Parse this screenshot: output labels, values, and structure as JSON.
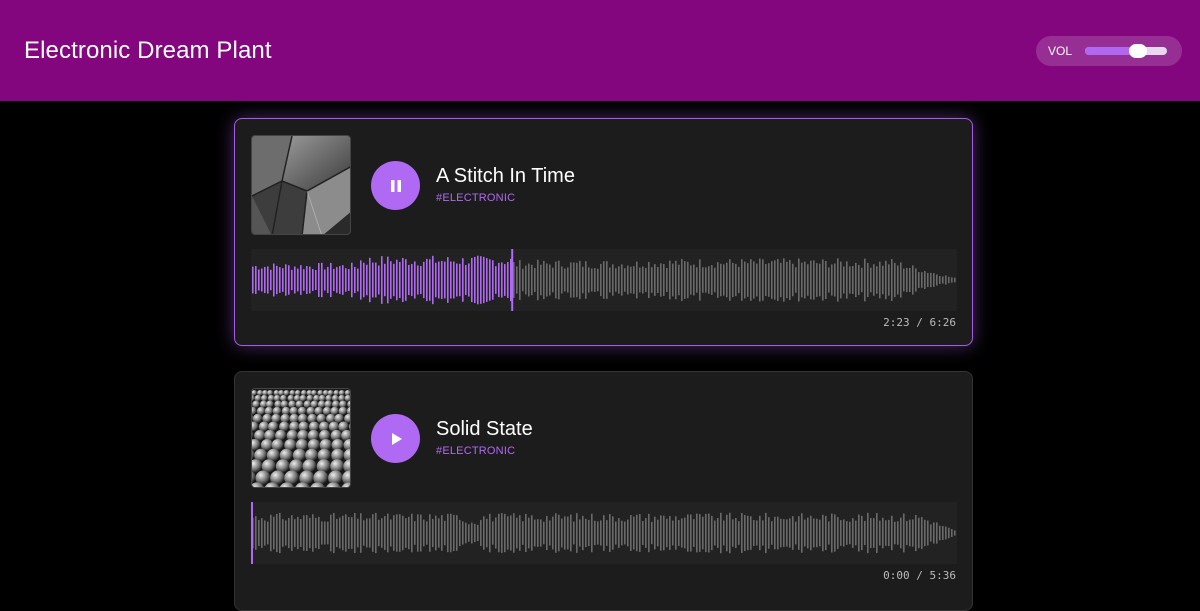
{
  "header": {
    "title": "Electronic Dream Plant",
    "volume_label": "VOL",
    "volume_level": 0.65,
    "bg_color": "#84067f"
  },
  "accent_color": "#b069f2",
  "tracks": [
    {
      "title": "A Stitch In Time",
      "tag": "#ELECTRONIC",
      "state": "playing",
      "control_icon": "pause-icon",
      "progress": 0.37,
      "time": "2:23 / 6:26",
      "cover": "geometric-glass-facade"
    },
    {
      "title": "Solid State",
      "tag": "#ELECTRONIC",
      "state": "paused",
      "control_icon": "play-icon",
      "progress": 0.0,
      "time": "0:00 / 5:36",
      "cover": "spheres-pile"
    }
  ]
}
